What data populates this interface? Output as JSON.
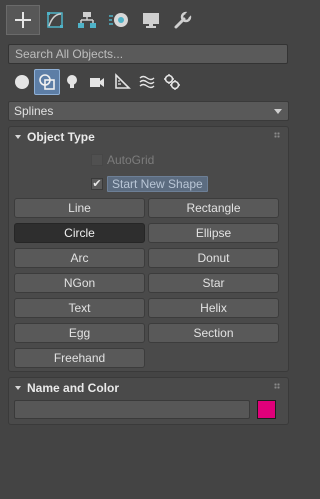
{
  "tabs": [
    {
      "name": "create",
      "icon": "plus-icon",
      "active": true
    },
    {
      "name": "modify",
      "icon": "modify-curve-icon",
      "active": false
    },
    {
      "name": "hierarchy",
      "icon": "hierarchy-icon",
      "active": false
    },
    {
      "name": "motion",
      "icon": "motion-icon",
      "active": false
    },
    {
      "name": "display",
      "icon": "display-monitor-icon",
      "active": false
    },
    {
      "name": "utilities",
      "icon": "wrench-icon",
      "active": false
    }
  ],
  "search": {
    "placeholder": "Search All Objects..."
  },
  "categories": [
    {
      "name": "geometry",
      "icon": "sphere-icon",
      "active": false
    },
    {
      "name": "shapes",
      "icon": "shapes-icon",
      "active": true
    },
    {
      "name": "lights",
      "icon": "light-bulb-icon",
      "active": false
    },
    {
      "name": "cameras",
      "icon": "camera-icon",
      "active": false
    },
    {
      "name": "helpers",
      "icon": "tape-measure-icon",
      "active": false
    },
    {
      "name": "space-warps",
      "icon": "waves-icon",
      "active": false
    },
    {
      "name": "systems",
      "icon": "gears-icon",
      "active": false
    }
  ],
  "dropdown": {
    "value": "Splines"
  },
  "object_type": {
    "title": "Object Type",
    "autogrid_label": "AutoGrid",
    "autogrid_checked": false,
    "start_new_shape_label": "Start New Shape",
    "start_new_shape_checked": true,
    "buttons": [
      "Line",
      "Rectangle",
      "Circle",
      "Ellipse",
      "Arc",
      "Donut",
      "NGon",
      "Star",
      "Text",
      "Helix",
      "Egg",
      "Section",
      "Freehand"
    ],
    "selected": "Circle"
  },
  "name_color": {
    "title": "Name and Color",
    "name_value": "",
    "color": "#e0007a"
  }
}
